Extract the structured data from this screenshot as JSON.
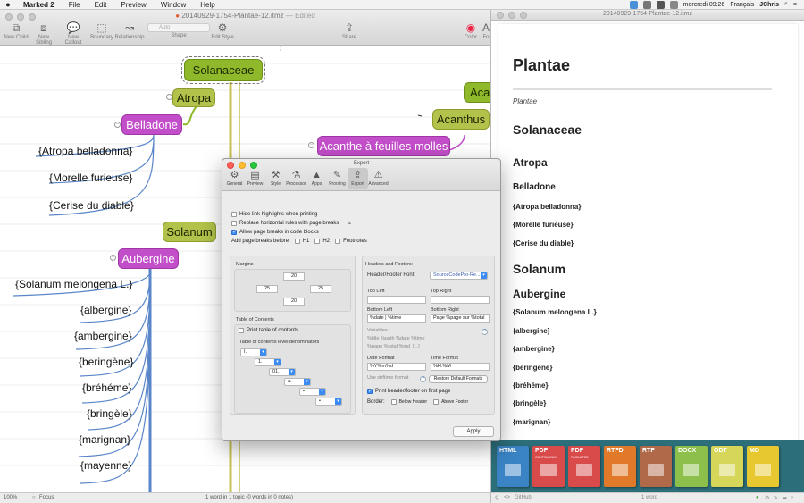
{
  "menubar": {
    "apple": "",
    "app": "Marked 2",
    "items": [
      "File",
      "Edit",
      "Preview",
      "Window",
      "Help"
    ],
    "clock": "mercredi 09:26",
    "language": "Français",
    "user": "JChris"
  },
  "mainwin": {
    "title": "20140929-1754-Plantae-12.itmz",
    "edited": "— Edited",
    "toolbar": {
      "new_child": "New Child",
      "new_sibling": "New Sibling",
      "new_callout": "New Callout",
      "boundary": "Boundary",
      "relationship": "Relationship",
      "auto": "Auto",
      "shape": "Shape",
      "edit_style": "Edit Style",
      "share": "Share",
      "color": "Color",
      "font": "Fo"
    },
    "nodes": {
      "solanaceae": "Solanaceae",
      "atropa": "Atropa",
      "belladone": "Belladone",
      "solanum": "Solanum",
      "aubergine": "Aubergine",
      "acan": "Acan",
      "acanthus": "Acanthus",
      "acanthe": "Acanthe à feuilles molles"
    },
    "leaves": {
      "atropa_belladonna": "{Atropa belladonna}",
      "morelle": "{Morelle furieuse}",
      "cerise": "{Cerise du diable}",
      "solanum_melongena": "{Solanum melongena L.}",
      "albergine": "{albergine}",
      "ambergine": "{ambergine}",
      "beringene": "{beringène}",
      "brehme": "{bréhéme}",
      "bringele": "{bringèle}",
      "marignan": "{marignan}",
      "mayenne": "{mayenne}"
    },
    "status": {
      "zoom": "100%",
      "focus": "Focus",
      "words": "1 word in 1 topic (0 words in 0 notes)"
    }
  },
  "dialog": {
    "title": "Export",
    "tabs": [
      "General",
      "Preview",
      "Style",
      "Processor",
      "Apps",
      "Proofing",
      "Export",
      "Advanced"
    ],
    "options": {
      "hide_link": "Hide link highlights when printing",
      "replace_rules": "Replace horizontal rules with page breaks",
      "allow_breaks": "Allow page breaks in code blocks",
      "add_breaks": "Add page breaks before:",
      "h1": "H1",
      "h2": "H2",
      "footnotes": "Footnotes"
    },
    "margins": {
      "label": "Margins",
      "top": "20",
      "left": "25",
      "right": "25",
      "bottom": "20"
    },
    "toc": {
      "label": "Table of Contents",
      "print": "Print table of contents",
      "denominators": "Table of contents level denominators",
      "levels": [
        "I.",
        "1.",
        "01.",
        "a.",
        "•",
        "•"
      ]
    },
    "hf": {
      "label": "Headers and Footers:",
      "font_label": "Header/Footer Font:",
      "font": "SourceCodePro-Re...",
      "top_left": "Top Left",
      "top_right": "Top Right",
      "bottom_left": "Bottom Left",
      "bottom_right": "Bottom Right",
      "bottom_left_val": "%date | %time",
      "bottom_right_val": "Page %page sur %total",
      "variables": "Variables:",
      "vars_row1": "%title    %path    %date    %time",
      "vars_row2": "%page   %total   %md_[...]",
      "date_format": "Date Format",
      "time_format": "Time Format",
      "date_val": "%Y%m%d",
      "time_val": "%H:%M",
      "strftime": "Use strftime format",
      "restore": "Restore Default Formats",
      "print_first": "Print header/footer on first page",
      "border": "Border:",
      "below_header": "Below Header",
      "above_footer": "Above Footer"
    },
    "apply": "Apply"
  },
  "preview": {
    "title": "20140929-1754-Plantae-12.itmz",
    "h1": "Plantae",
    "italic": "Plantae",
    "items": [
      {
        "text": "Solanaceae",
        "level": "h2"
      },
      {
        "text": "Atropa",
        "level": "h3"
      },
      {
        "text": "Belladone",
        "level": "h4"
      },
      {
        "text": "{Atropa belladonna}",
        "level": "small"
      },
      {
        "text": "{Morelle furieuse}",
        "level": "small"
      },
      {
        "text": "{Cerise du diable}",
        "level": "small"
      },
      {
        "text": "Solanum",
        "level": "h2"
      },
      {
        "text": "Aubergine",
        "level": "h3"
      },
      {
        "text": "{Solanum melongena L.}",
        "level": "small"
      },
      {
        "text": "{albergine}",
        "level": "small"
      },
      {
        "text": "{ambergine}",
        "level": "small"
      },
      {
        "text": "{beringène}",
        "level": "small"
      },
      {
        "text": "{bréhéme}",
        "level": "small"
      },
      {
        "text": "{bringèle}",
        "level": "small"
      },
      {
        "text": "{marignan}",
        "level": "small"
      }
    ],
    "formats": [
      {
        "label": "HTML",
        "sub": "",
        "color": "#3a83c4"
      },
      {
        "label": "PDF",
        "sub": "CONTINUOUS",
        "color": "#d94a4a"
      },
      {
        "label": "PDF",
        "sub": "PAGINATED",
        "color": "#d94a4a"
      },
      {
        "label": "RTFD",
        "sub": "",
        "color": "#e07a2a"
      },
      {
        "label": "RTF",
        "sub": "",
        "color": "#b06a4a"
      },
      {
        "label": "DOCX",
        "sub": "",
        "color": "#8cc04a"
      },
      {
        "label": "ODT",
        "sub": "",
        "color": "#d6d65a"
      },
      {
        "label": "MD",
        "sub": "",
        "color": "#e8c830"
      }
    ],
    "status": {
      "github": "GitHub",
      "words": "1 word"
    }
  }
}
